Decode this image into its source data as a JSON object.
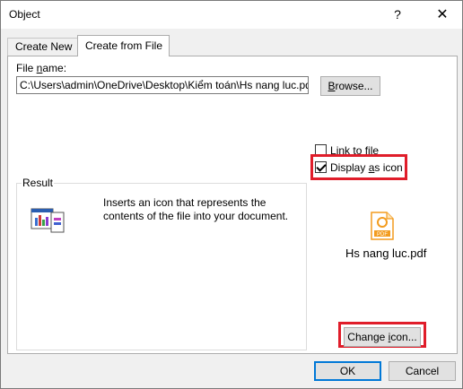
{
  "window": {
    "title": "Object",
    "help_label": "?",
    "close_label": "✕"
  },
  "tabs": [
    {
      "label": "Create New",
      "selected": false
    },
    {
      "label": "Create from File",
      "selected": true
    }
  ],
  "file": {
    "label_prefix": "File ",
    "label_underlined": "n",
    "label_suffix": "ame:",
    "value": "C:\\Users\\admin\\OneDrive\\Desktop\\Kiểm toán\\Hs nang luc.pdf",
    "browse_label_underlined": "B",
    "browse_label_rest": "rowse..."
  },
  "options": {
    "link_prefix": "",
    "link_underlined": "L",
    "link_suffix": "ink to file",
    "link_checked": false,
    "display_prefix": "Display ",
    "display_underlined": "a",
    "display_suffix": "s icon",
    "display_checked": true
  },
  "result": {
    "legend": "Result",
    "text": "Inserts an icon that represents the contents of the file into your document."
  },
  "preview": {
    "icon": "pdf-file-icon",
    "filename": "Hs nang luc.pdf",
    "badge": "PDF"
  },
  "buttons": {
    "change_icon_prefix": "Change ",
    "change_icon_underlined": "i",
    "change_icon_suffix": "con...",
    "ok": "OK",
    "cancel": "Cancel"
  },
  "colors": {
    "highlight": "#e01d2a",
    "pdf_orange": "#f39c1f"
  }
}
